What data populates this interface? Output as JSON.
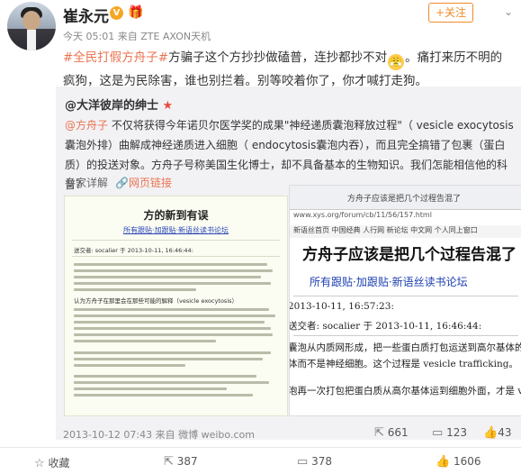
{
  "header": {
    "username": "崔永元",
    "v_badge": "V",
    "follow_label": "+关注",
    "meta": "今天 05:01 来自 ZTE AXON天机"
  },
  "post": {
    "tag": "#全民打假方舟子#",
    "text_1": "方骗子这个方抄抄做磕普，连抄都抄不对",
    "text_2": "。痛打来历不明的疯狗，这是为民除害，谁也别拦着。别等咬着你了，你才喊打走狗。"
  },
  "quote": {
    "user": "@大洋彼岸的绅士",
    "mention": "@方舟子",
    "text": " 不仅将获得今年诺贝尔医学奖的成果\"神经递质囊泡释放过程\"（ vesicle exocytosis囊泡外排）曲解成神经递质进入细胞（ endocytosis囊泡内吞），而且完全搞错了包裹（蛋白质）的投送对象。方舟子号称美国生化博士，却不具备基本的生物知识。我们怎能相信他的科普？",
    "detail_label": "专家详解",
    "web_link": "网页链接"
  },
  "image1": {
    "title": "方的新到有误",
    "links": "所有跟贴·加跟贴·新语丝读书论坛",
    "sender": "送交者: socalier 于 2013-10-11, 16:46:44:",
    "para_label": "认为方舟子在那里会在那些可能的解释（vesicle exocytosis）"
  },
  "image2": {
    "tab": "方舟子应该是把几个过程告混了",
    "url": "www.xys.org/forum/cb/11/56/157.html",
    "nav": "新语丝首页  中国经典  人行网  新论坛  中文网  个人同上窗口",
    "headline": "方舟子应该是把几个过程告混了",
    "links": "所有跟贴·加跟贴·新语丝读书论坛",
    "line_date": "2013-10-11, 16:57:23:",
    "line_sender": "送交者: socalier 于 2013-10-11, 16:46:44:",
    "line_a": "囊泡从内质网形成，把一些蛋白质打包运送到高尔基体的",
    "line_b": "体而不是神经细胞。这个过程是 vesicle trafficking。",
    "line_c": "泡再一次打包把蛋白质从高尔基体运到细胞外面，才是 ve"
  },
  "footer": {
    "timestamp": "2013-10-12 07:43 来自 微博 weibo.com",
    "share_count": "661",
    "comment_count": "123",
    "like_count": "43"
  },
  "bottom_bar": {
    "favorite": "收藏",
    "forward": "387",
    "comment": "378",
    "like": "1606"
  },
  "colors": {
    "accent": "#eb7350",
    "follow": "#f08b2a",
    "link_blue": "#1c3fb0"
  },
  "icons": [
    "verified-badge-icon",
    "gift-icon",
    "chevron-down-icon",
    "emoji-icon",
    "star-icon",
    "link-icon",
    "share-icon",
    "comment-icon",
    "like-icon",
    "favorite-icon"
  ]
}
